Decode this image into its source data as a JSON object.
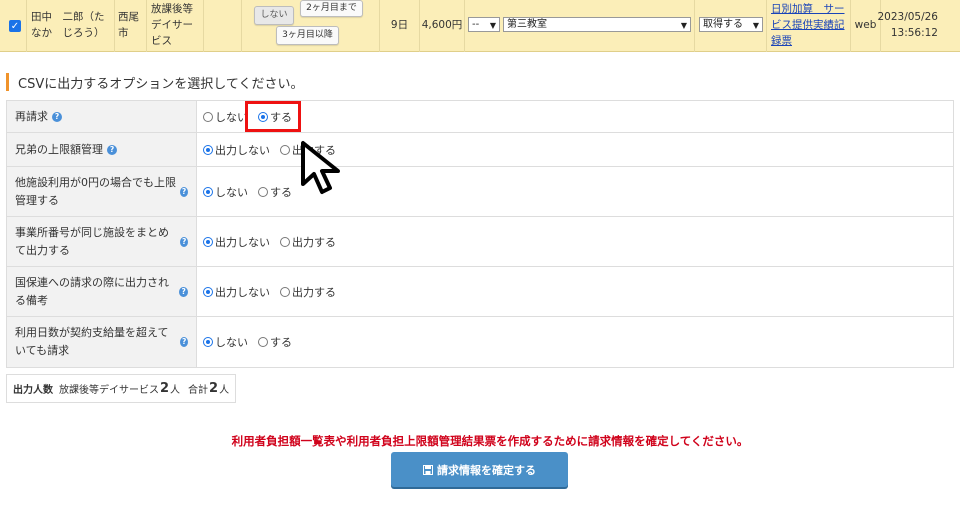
{
  "top_row": {
    "checked": true,
    "name": "田中　二郎（たなか　じろう）",
    "city": "西尾市",
    "service": "放課後等デイサービス",
    "btn_no": "しない",
    "btn_two_months": "2ヶ月目まで",
    "btn_three_months": "3ヶ月目以降",
    "days": "9日",
    "amount": "4,600円",
    "select_small": "--",
    "select_classroom": "第三教室",
    "select_action": "取得する",
    "link_text": "日別加算　サービス提供実績記録票",
    "source": "web",
    "date": "2023/05/26",
    "time": "13:56:12"
  },
  "section": {
    "title": "CSVに出力するオプションを選択してください。"
  },
  "options": [
    {
      "label": "再請求",
      "choices": [
        "しない",
        "する"
      ],
      "selected": 1
    },
    {
      "label": "兄弟の上限額管理",
      "choices": [
        "出力しない",
        "出力する"
      ],
      "selected": 0
    },
    {
      "label": "他施設利用が0円の場合でも上限管理する",
      "choices": [
        "しない",
        "する"
      ],
      "selected": 0
    },
    {
      "label": "事業所番号が同じ施設をまとめて出力する",
      "choices": [
        "出力しない",
        "出力する"
      ],
      "selected": 0
    },
    {
      "label": "国保連への請求の際に出力される備考",
      "choices": [
        "出力しない",
        "出力する"
      ],
      "selected": 0
    },
    {
      "label": "利用日数が契約支給量を超えていても請求",
      "choices": [
        "しない",
        "する"
      ],
      "selected": 0
    }
  ],
  "summary": {
    "label": "出力人数",
    "service": "放課後等デイサービス",
    "service_count": "2",
    "unit": "人",
    "total_label": "合計",
    "total_count": "2"
  },
  "notice": "利用者負担額一覧表や利用者負担上限額管理結果票を作成するために請求情報を確定してください。",
  "confirm_button": "請求情報を確定する",
  "colors": {
    "highlight_row": "#fbeeb8",
    "accent": "#f0932b",
    "primary_button": "#4a90c8",
    "notice": "#d0021b",
    "annotation_box": "#e11111"
  }
}
